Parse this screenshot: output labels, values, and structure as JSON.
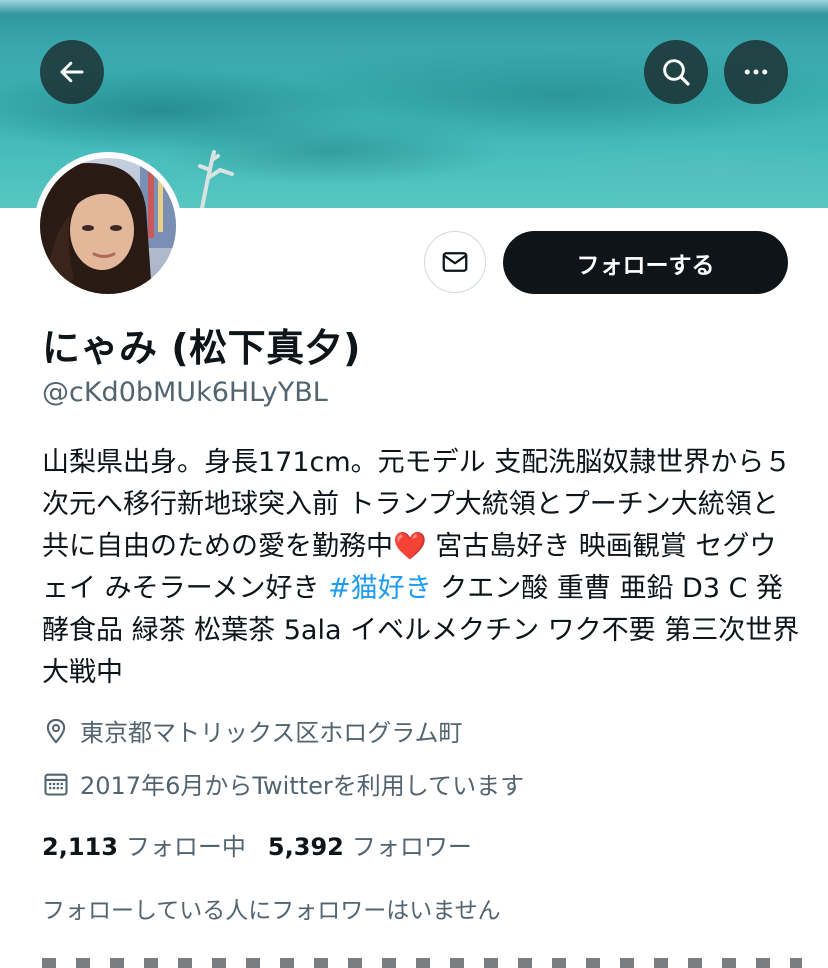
{
  "header": {
    "back_icon": "arrow-left-icon",
    "search_icon": "search-icon",
    "more_icon": "more-dots-icon"
  },
  "actions": {
    "message_icon": "mail-icon",
    "follow_label": "フォローする"
  },
  "profile": {
    "name": "にゃみ (松下真夕)",
    "handle": "@cKd0bMUk6HLyYBL",
    "bio_part1": "山梨県出身。身長171cm。元モデル 支配洗脳奴隷世界から５次元へ移行新地球突入前 トランプ大統領とプーチン大統領と共に自由のための愛を勤務中",
    "bio_emoji": "❤️",
    "bio_part2": " 宮古島好き 映画観賞 セグウェイ みそラーメン好き ",
    "bio_hashtag": "#猫好き",
    "bio_part3": " クエン酸 重曹 亜鉛 D3 C 発酵食品 緑茶 松葉茶 5ala イベルメクチン ワク不要 第三次世界大戦中",
    "location": "東京都マトリックス区ホログラム町",
    "joined": "2017年6月からTwitterを利用しています"
  },
  "stats": {
    "following_count": "2,113",
    "following_label": "フォロー中",
    "followers_count": "5,392",
    "followers_label": "フォロワー"
  },
  "followers_you_know": "フォローしている人にフォロワーはいません",
  "colors": {
    "accent": "#1d9bf0",
    "text_primary": "#0f1419",
    "text_secondary": "#536471",
    "follow_button_bg": "#0f1419"
  }
}
